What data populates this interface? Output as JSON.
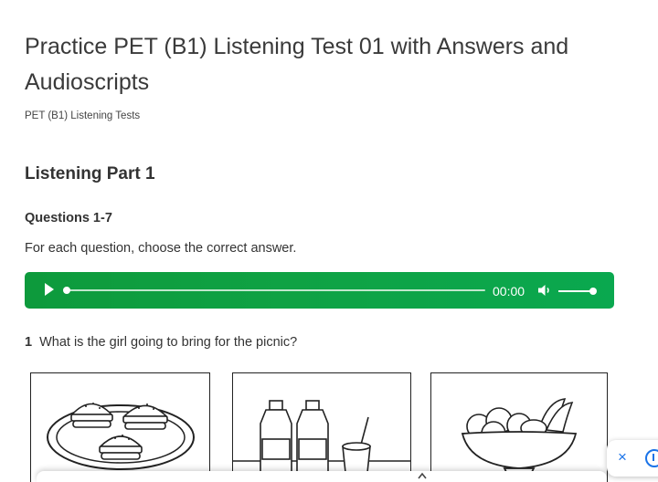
{
  "article": {
    "title": "Practice PET (B1) Listening Test 01 with Answers and Audioscripts",
    "breadcrumb": "PET (B1) Listening Tests"
  },
  "section": {
    "heading": "Listening Part 1",
    "questions_range": "Questions 1-7",
    "instruction": "For each question, choose the correct answer."
  },
  "player": {
    "time": "00:00",
    "progress": 0,
    "volume": 1,
    "color": "#0fa244",
    "play_icon": "play-icon",
    "volume_icon": "volume-icon"
  },
  "question": {
    "number": "1",
    "text": "What is the girl going to bring for the picnic?"
  },
  "options": [
    {
      "name": "option-a-burgers"
    },
    {
      "name": "option-b-drinks"
    },
    {
      "name": "option-c-fruit"
    }
  ],
  "widget": {
    "close_icon": "×",
    "action_icon": "arrow-up-circle-icon",
    "accent": "#1a73e8"
  }
}
